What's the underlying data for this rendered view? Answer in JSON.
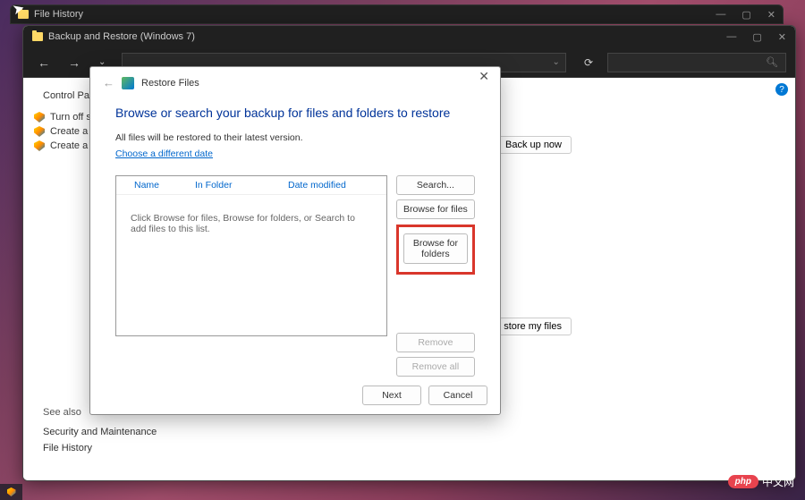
{
  "win1": {
    "title": "File History"
  },
  "win2": {
    "title": "Backup and Restore (Windows 7)"
  },
  "breadcrumb": "Control Panel",
  "sidebar": {
    "items": [
      {
        "label": "Turn off sche"
      },
      {
        "label": "Create a syste"
      },
      {
        "label": "Create a syste"
      }
    ]
  },
  "right_buttons": {
    "backup": "Back up now",
    "restore": "store my files"
  },
  "see_also": {
    "heading": "See also",
    "links": [
      "Security and Maintenance",
      "File History"
    ]
  },
  "dialog": {
    "title": "Restore Files",
    "heading": "Browse or search your backup for files and folders to restore",
    "sub": "All files will be restored to their latest version.",
    "link": "Choose a different date",
    "columns": {
      "name": "Name",
      "folder": "In Folder",
      "date": "Date modified"
    },
    "empty_text": "Click Browse for files, Browse for folders, or Search to add files to this list.",
    "buttons": {
      "search": "Search...",
      "browse_files": "Browse for files",
      "browse_folders": "Browse for folders",
      "remove": "Remove",
      "remove_all": "Remove all"
    },
    "footer": {
      "next": "Next",
      "cancel": "Cancel"
    }
  },
  "watermark": {
    "pill": "php",
    "text": "中文网"
  }
}
